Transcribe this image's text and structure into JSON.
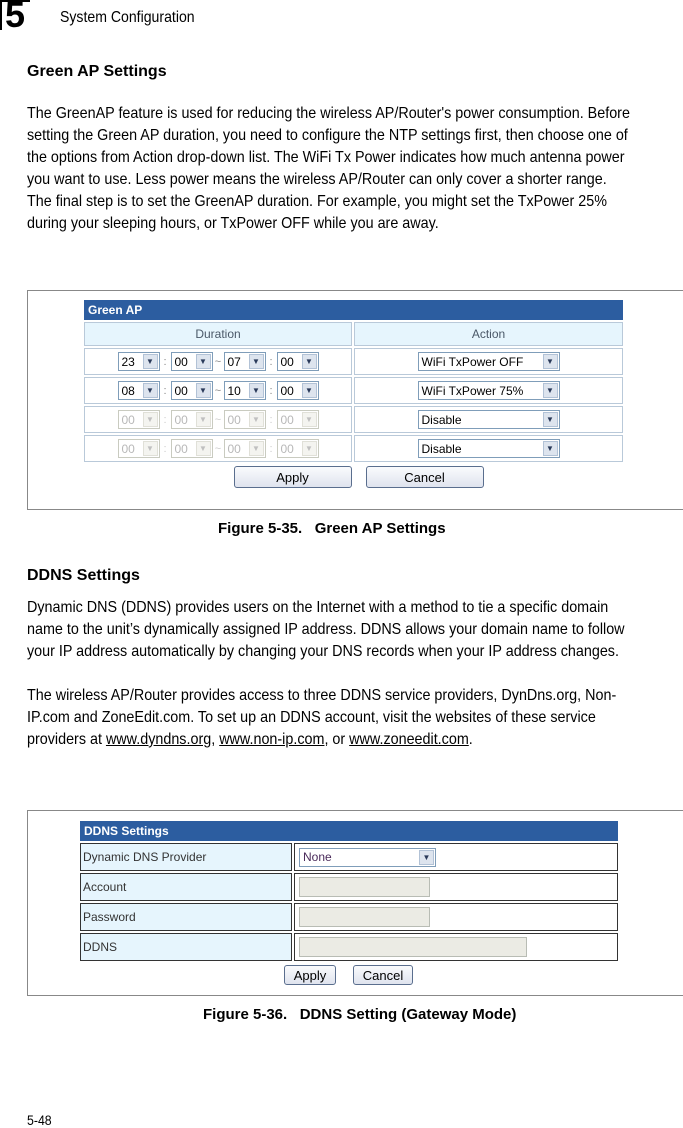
{
  "header": {
    "chapter_number": "5",
    "running_title": "System Configuration"
  },
  "green_ap_section": {
    "heading": "Green AP Settings",
    "body": "The GreenAP feature is used for reducing the wireless AP/Router's power consumption. Before setting the Green AP duration, you need to configure the NTP settings first, then choose one of the options from Action drop-down list. The WiFi Tx Power indicates how much antenna power you want to use. Less power means the wireless AP/Router can only cover a shorter range. The final step is to set the GreenAP duration. For example, you might set the TxPower 25% during your sleeping hours, or TxPower OFF while you are away."
  },
  "green_ap_ui": {
    "title": "Green AP",
    "col_duration": "Duration",
    "col_action": "Action",
    "colon": ":",
    "tilde": "~",
    "rows": [
      {
        "start_h": "23",
        "start_m": "00",
        "end_h": "07",
        "end_m": "00",
        "action": "WiFi TxPower OFF",
        "enabled": true
      },
      {
        "start_h": "08",
        "start_m": "00",
        "end_h": "10",
        "end_m": "00",
        "action": "WiFi TxPower 75%",
        "enabled": true
      },
      {
        "start_h": "00",
        "start_m": "00",
        "end_h": "00",
        "end_m": "00",
        "action": "Disable",
        "enabled": false
      },
      {
        "start_h": "00",
        "start_m": "00",
        "end_h": "00",
        "end_m": "00",
        "action": "Disable",
        "enabled": false
      }
    ],
    "apply_label": "Apply",
    "cancel_label": "Cancel"
  },
  "figure_35_caption": "Figure 5-35.   Green AP Settings",
  "ddns_section": {
    "heading": "DDNS Settings",
    "body1": "Dynamic DNS (DDNS) provides users on the Internet with a method to tie a specific domain name to the unit’s dynamically assigned IP address. DDNS allows your domain name to follow your IP address automatically by changing your DNS records when your IP address changes.",
    "body2_pre": "The wireless AP/Router provides access to three DDNS service providers, DynDns.org, Non-IP.com and ZoneEdit.com. To set up an DDNS account, visit the websites of these service providers at ",
    "link1": "www.dyndns.org",
    "sep1": ", ",
    "link2": "www.non-ip.com",
    "sep2": ", or ",
    "link3": "www.zoneedit.com",
    "end": "."
  },
  "ddns_ui": {
    "title": "DDNS Settings",
    "provider_label": "Dynamic DNS Provider",
    "provider_value": "None",
    "account_label": "Account",
    "account_value": "",
    "password_label": "Password",
    "password_value": "",
    "ddns_label": "DDNS",
    "ddns_value": "",
    "apply_label": "Apply",
    "cancel_label": "Cancel"
  },
  "figure_36_caption": "Figure 5-36.   DDNS Setting (Gateway Mode)",
  "footer": {
    "page_number": "5-48"
  }
}
